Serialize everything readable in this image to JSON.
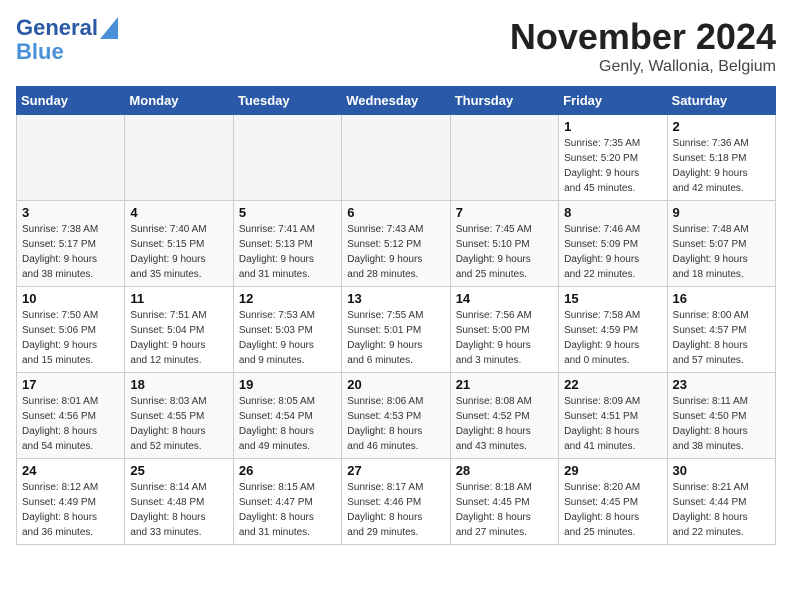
{
  "logo": {
    "line1": "General",
    "line2": "Blue"
  },
  "title": {
    "month_year": "November 2024",
    "location": "Genly, Wallonia, Belgium"
  },
  "weekdays": [
    "Sunday",
    "Monday",
    "Tuesday",
    "Wednesday",
    "Thursday",
    "Friday",
    "Saturday"
  ],
  "weeks": [
    [
      {
        "day": "",
        "info": ""
      },
      {
        "day": "",
        "info": ""
      },
      {
        "day": "",
        "info": ""
      },
      {
        "day": "",
        "info": ""
      },
      {
        "day": "",
        "info": ""
      },
      {
        "day": "1",
        "info": "Sunrise: 7:35 AM\nSunset: 5:20 PM\nDaylight: 9 hours\nand 45 minutes."
      },
      {
        "day": "2",
        "info": "Sunrise: 7:36 AM\nSunset: 5:18 PM\nDaylight: 9 hours\nand 42 minutes."
      }
    ],
    [
      {
        "day": "3",
        "info": "Sunrise: 7:38 AM\nSunset: 5:17 PM\nDaylight: 9 hours\nand 38 minutes."
      },
      {
        "day": "4",
        "info": "Sunrise: 7:40 AM\nSunset: 5:15 PM\nDaylight: 9 hours\nand 35 minutes."
      },
      {
        "day": "5",
        "info": "Sunrise: 7:41 AM\nSunset: 5:13 PM\nDaylight: 9 hours\nand 31 minutes."
      },
      {
        "day": "6",
        "info": "Sunrise: 7:43 AM\nSunset: 5:12 PM\nDaylight: 9 hours\nand 28 minutes."
      },
      {
        "day": "7",
        "info": "Sunrise: 7:45 AM\nSunset: 5:10 PM\nDaylight: 9 hours\nand 25 minutes."
      },
      {
        "day": "8",
        "info": "Sunrise: 7:46 AM\nSunset: 5:09 PM\nDaylight: 9 hours\nand 22 minutes."
      },
      {
        "day": "9",
        "info": "Sunrise: 7:48 AM\nSunset: 5:07 PM\nDaylight: 9 hours\nand 18 minutes."
      }
    ],
    [
      {
        "day": "10",
        "info": "Sunrise: 7:50 AM\nSunset: 5:06 PM\nDaylight: 9 hours\nand 15 minutes."
      },
      {
        "day": "11",
        "info": "Sunrise: 7:51 AM\nSunset: 5:04 PM\nDaylight: 9 hours\nand 12 minutes."
      },
      {
        "day": "12",
        "info": "Sunrise: 7:53 AM\nSunset: 5:03 PM\nDaylight: 9 hours\nand 9 minutes."
      },
      {
        "day": "13",
        "info": "Sunrise: 7:55 AM\nSunset: 5:01 PM\nDaylight: 9 hours\nand 6 minutes."
      },
      {
        "day": "14",
        "info": "Sunrise: 7:56 AM\nSunset: 5:00 PM\nDaylight: 9 hours\nand 3 minutes."
      },
      {
        "day": "15",
        "info": "Sunrise: 7:58 AM\nSunset: 4:59 PM\nDaylight: 9 hours\nand 0 minutes."
      },
      {
        "day": "16",
        "info": "Sunrise: 8:00 AM\nSunset: 4:57 PM\nDaylight: 8 hours\nand 57 minutes."
      }
    ],
    [
      {
        "day": "17",
        "info": "Sunrise: 8:01 AM\nSunset: 4:56 PM\nDaylight: 8 hours\nand 54 minutes."
      },
      {
        "day": "18",
        "info": "Sunrise: 8:03 AM\nSunset: 4:55 PM\nDaylight: 8 hours\nand 52 minutes."
      },
      {
        "day": "19",
        "info": "Sunrise: 8:05 AM\nSunset: 4:54 PM\nDaylight: 8 hours\nand 49 minutes."
      },
      {
        "day": "20",
        "info": "Sunrise: 8:06 AM\nSunset: 4:53 PM\nDaylight: 8 hours\nand 46 minutes."
      },
      {
        "day": "21",
        "info": "Sunrise: 8:08 AM\nSunset: 4:52 PM\nDaylight: 8 hours\nand 43 minutes."
      },
      {
        "day": "22",
        "info": "Sunrise: 8:09 AM\nSunset: 4:51 PM\nDaylight: 8 hours\nand 41 minutes."
      },
      {
        "day": "23",
        "info": "Sunrise: 8:11 AM\nSunset: 4:50 PM\nDaylight: 8 hours\nand 38 minutes."
      }
    ],
    [
      {
        "day": "24",
        "info": "Sunrise: 8:12 AM\nSunset: 4:49 PM\nDaylight: 8 hours\nand 36 minutes."
      },
      {
        "day": "25",
        "info": "Sunrise: 8:14 AM\nSunset: 4:48 PM\nDaylight: 8 hours\nand 33 minutes."
      },
      {
        "day": "26",
        "info": "Sunrise: 8:15 AM\nSunset: 4:47 PM\nDaylight: 8 hours\nand 31 minutes."
      },
      {
        "day": "27",
        "info": "Sunrise: 8:17 AM\nSunset: 4:46 PM\nDaylight: 8 hours\nand 29 minutes."
      },
      {
        "day": "28",
        "info": "Sunrise: 8:18 AM\nSunset: 4:45 PM\nDaylight: 8 hours\nand 27 minutes."
      },
      {
        "day": "29",
        "info": "Sunrise: 8:20 AM\nSunset: 4:45 PM\nDaylight: 8 hours\nand 25 minutes."
      },
      {
        "day": "30",
        "info": "Sunrise: 8:21 AM\nSunset: 4:44 PM\nDaylight: 8 hours\nand 22 minutes."
      }
    ]
  ]
}
